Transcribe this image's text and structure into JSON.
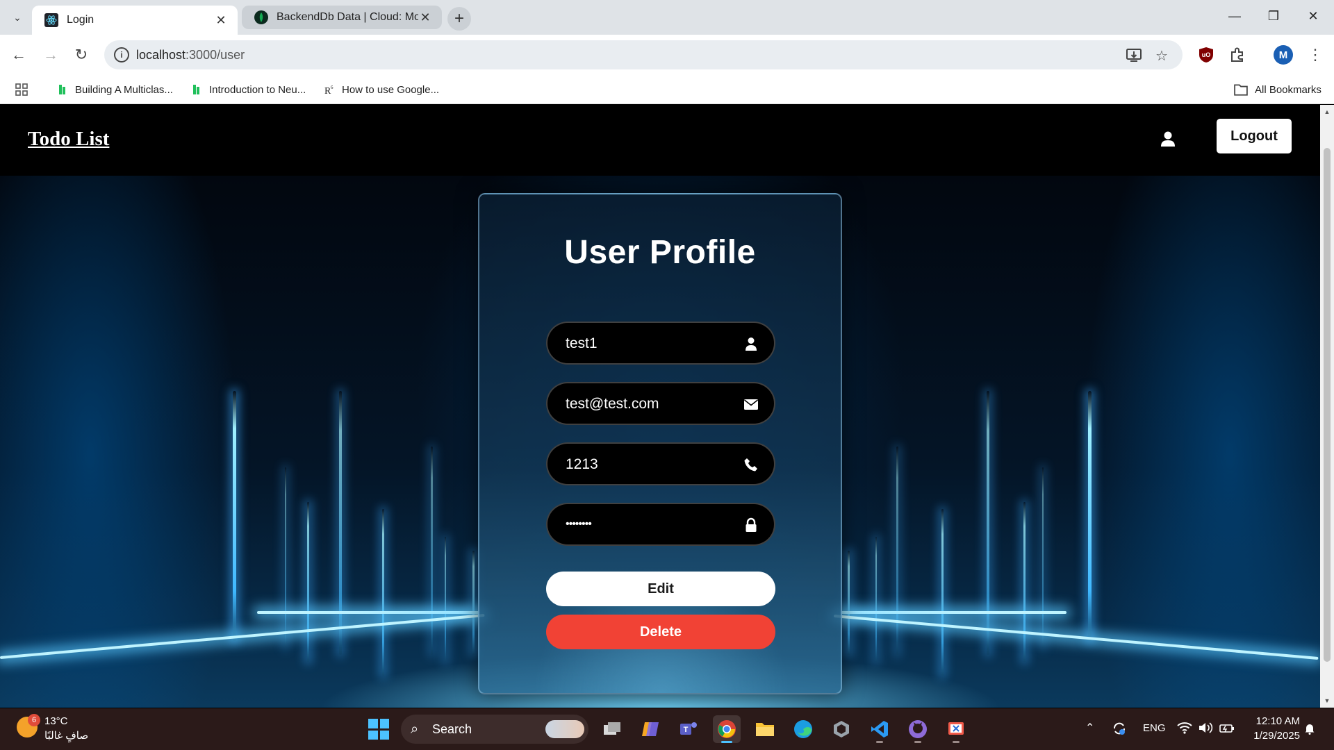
{
  "browser": {
    "tabs": [
      {
        "title": "Login",
        "active": true
      },
      {
        "title": "BackendDb Data | Cloud: MongoDB Cloud",
        "active": false
      }
    ],
    "url": {
      "host": "localhost",
      "path": ":3000/user"
    },
    "profile_initial": "M",
    "bookmarks": [
      {
        "label": "Building A Multiclas..."
      },
      {
        "label": "Introduction to Neu..."
      },
      {
        "label": "How to use Google..."
      }
    ],
    "all_bookmarks": "All Bookmarks"
  },
  "app": {
    "brand": "Todo List",
    "logout_label": "Logout",
    "profile": {
      "title": "User Profile",
      "fields": {
        "username": "test1",
        "email": "test@test.com",
        "phone": "1213",
        "password": "••••••••"
      },
      "edit_label": "Edit",
      "delete_label": "Delete"
    },
    "colors": {
      "delete": "#f14235",
      "accent_glow": "#3fb8ff"
    }
  },
  "taskbar": {
    "weather": {
      "badge": "6",
      "temp": "13°C",
      "condition": "صافٍ غالبًا"
    },
    "search_label": "Search",
    "language": "ENG",
    "time": "12:10 AM",
    "date": "1/29/2025"
  }
}
